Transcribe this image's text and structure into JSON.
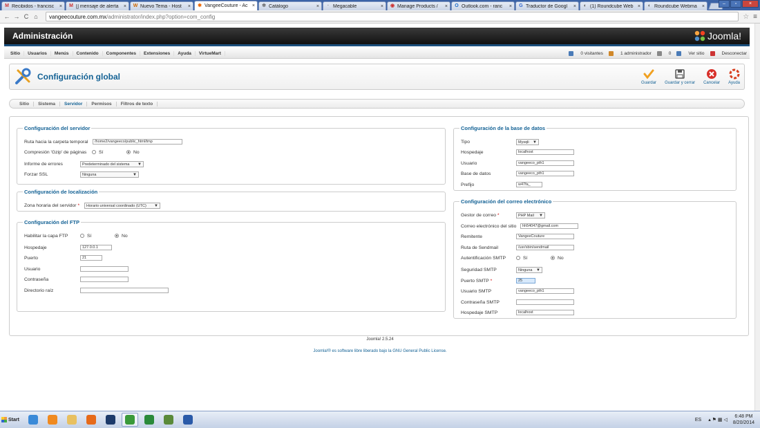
{
  "browser": {
    "tabs": [
      {
        "label": "Recibidos - francisc",
        "icon": "gmail-icon",
        "glyph": "M",
        "color": "#c33"
      },
      {
        "label": "[] mensaje de alerta",
        "icon": "gmail-icon",
        "glyph": "M",
        "color": "#c33"
      },
      {
        "label": "Nuevo Tema - Host",
        "icon": "forum-icon",
        "glyph": "W",
        "color": "#c60"
      },
      {
        "label": "VangeeCouture - Ac",
        "icon": "joomla-icon",
        "glyph": "✱",
        "color": "#e60",
        "active": true
      },
      {
        "label": "Catálogo",
        "icon": "catalog-icon",
        "glyph": "✲",
        "color": "#555"
      },
      {
        "label": "Megacable",
        "icon": "page-icon",
        "glyph": "·",
        "color": "#888"
      },
      {
        "label": "Manage Products /",
        "icon": "shop-icon",
        "glyph": "◉",
        "color": "#c33"
      },
      {
        "label": "Outlook.com - ranc",
        "icon": "outlook-icon",
        "glyph": "O",
        "color": "#1b6ac9"
      },
      {
        "label": "Traductor de Googl",
        "icon": "translate-icon",
        "glyph": "G",
        "color": "#36c"
      },
      {
        "label": "(1) Roundcube Web",
        "icon": "roundcube-icon",
        "glyph": "◐",
        "color": "#555"
      },
      {
        "label": "Roundcube Webma",
        "icon": "roundcube-icon",
        "glyph": "◐",
        "color": "#555"
      }
    ],
    "close_glyph": "×",
    "win": {
      "min": "–",
      "max": "▫",
      "close": "×"
    },
    "url_host": "vangeecouture.com.mx",
    "url_path": "/administrator/index.php?option=com_config",
    "nav": {
      "back": "←",
      "forward": "→",
      "reload": "C",
      "home": "⌂",
      "star": "☆",
      "menu": "≡"
    }
  },
  "admin": {
    "title": "Administración",
    "logo_text": "Joomla!",
    "menu": [
      "Sitio",
      "Usuarios",
      "Menús",
      "Contenido",
      "Componentes",
      "Extensiones",
      "Ayuda",
      "VirtueMart"
    ],
    "status": [
      {
        "text": "0 visitantes",
        "color": "#4a7bb7"
      },
      {
        "text": "1 administrador",
        "color": "#d0882a"
      },
      {
        "text": "0",
        "color": "#888"
      },
      {
        "text": "Ver sitio",
        "color": "#4a7bb7"
      },
      {
        "text": "Desconectar",
        "color": "#c33"
      }
    ]
  },
  "toolbar": {
    "page_title": "Configuración global",
    "buttons": [
      {
        "label": "Guardar",
        "name": "save-button",
        "icon": "checkmark-icon"
      },
      {
        "label": "Guardar y cerrar",
        "name": "save-close-button",
        "icon": "floppy-disk-icon"
      },
      {
        "label": "Cancelar",
        "name": "cancel-button",
        "icon": "cancel-icon"
      },
      {
        "label": "Ayuda",
        "name": "help-button",
        "icon": "lifebuoy-icon"
      }
    ],
    "colors": {
      "save": "#f0a020",
      "cancel": "#d8302a",
      "help": "#d84020",
      "title": "#146295"
    }
  },
  "subtabs": [
    "Sitio",
    "Sistema",
    "Servidor",
    "Permisos",
    "Filtros de texto"
  ],
  "subtab_active": "Servidor",
  "server": {
    "legend": "Configuración del servidor",
    "tmp_label": "Ruta hacia la carpeta temporal",
    "tmp_value": "/home2/vangeeco/public_html/tmp",
    "gzip_label": "Compresión 'Gzip' de páginas",
    "yes": "Sí",
    "no": "No",
    "errors_label": "Informe de errores",
    "errors_value": "Predeterminado del sistema",
    "ssl_label": "Forzar SSL",
    "ssl_value": "Ninguna"
  },
  "locale": {
    "legend": "Configuración de localización",
    "tz_label": "Zona horaria del servidor",
    "required_mark": "*",
    "tz_value": "Horario universal coordinado (UTC)"
  },
  "ftp": {
    "legend": "Configuración del FTP",
    "enable_label": "Habilitar la capa FTP",
    "host_label": "Hospedaje",
    "host_value": "127.0.0.1",
    "port_label": "Puerto",
    "port_value": "21",
    "user_label": "Usuario",
    "user_value": "",
    "pass_label": "Contraseña",
    "pass_value": "",
    "root_label": "Directorio raíz",
    "root_value": ""
  },
  "database": {
    "legend": "Configuración de la base de datos",
    "type_label": "Tipo",
    "type_value": "Mysqli",
    "host_label": "Hospedaje",
    "host_value": "localhost",
    "user_label": "Usuario",
    "user_value": "vangeeco_pth1",
    "db_label": "Base de datos",
    "db_value": "vangeeco_pth1",
    "prefix_label": "Prefijo",
    "prefix_value": "w47fa_"
  },
  "mail": {
    "legend": "Configuración del correo electrónico",
    "mailer_label": "Gestor de correo",
    "mailer_value": "PHP Mail",
    "from_label": "Correo electrónico del sitio",
    "from_value": "hh54047@gmail.com",
    "sender_label": "Remitente",
    "sender_value": "VangeeCouture",
    "sendmail_label": "Ruta de Sendmail",
    "sendmail_value": "/usr/sbin/sendmail",
    "smtpauth_label": "Autentificación SMTP",
    "smtpsec_label": "Seguridad SMTP",
    "smtpsec_value": "Ninguna",
    "smtpport_label": "Puerto SMTP",
    "smtpport_value": "25",
    "smtpuser_label": "Usuario SMTP",
    "smtpuser_value": "vangeeco_pth1",
    "smtppass_label": "Contraseña SMTP",
    "smtppass_value": "",
    "smtphost_label": "Hospedaje SMTP",
    "smtphost_value": "localhost"
  },
  "footer": {
    "version": "Joomla! 2.5.24",
    "license_prefix": "Joomla!® es software libre liberado bajo la",
    "license_link": "GNU General Public License."
  },
  "taskbar": {
    "start_label": "Start",
    "apps": [
      {
        "name": "ie-icon",
        "color": "#3a8ad8"
      },
      {
        "name": "media-player-icon",
        "color": "#f08a20"
      },
      {
        "name": "explorer-icon",
        "color": "#e8c060"
      },
      {
        "name": "firefox-icon",
        "color": "#e66a1a"
      },
      {
        "name": "photoshop-icon",
        "color": "#1c3a6a"
      },
      {
        "name": "chrome-icon",
        "color": "#3a9a3a",
        "active": true
      },
      {
        "name": "excel-icon",
        "color": "#2a8a3a"
      },
      {
        "name": "project-icon",
        "color": "#5a8a3a"
      },
      {
        "name": "word-icon",
        "color": "#2a5aa8"
      }
    ],
    "lang": "ES",
    "time": "6:48 PM",
    "date": "8/20/2014"
  }
}
